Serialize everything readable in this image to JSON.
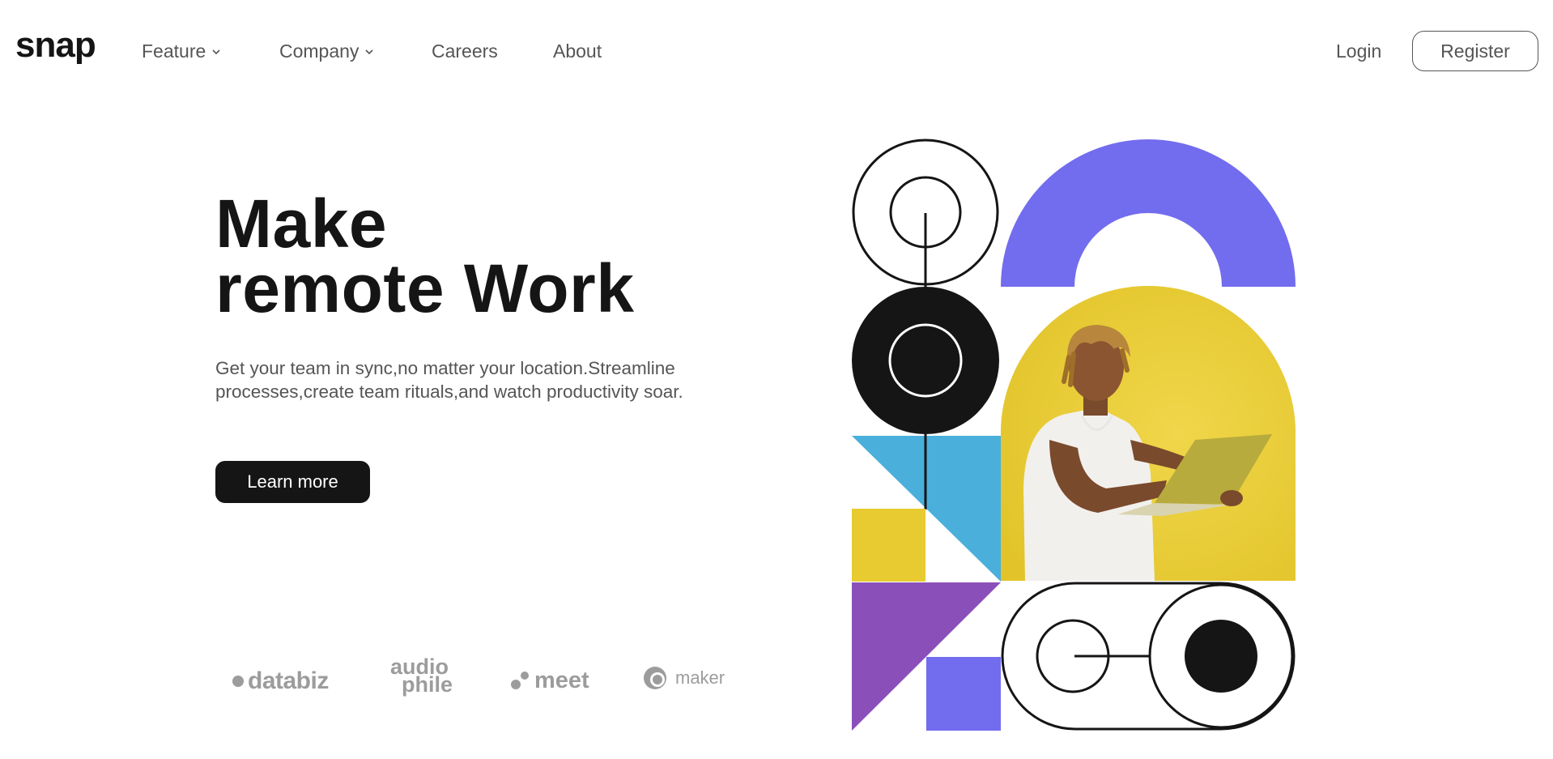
{
  "header": {
    "logo": "snap",
    "nav": [
      {
        "label": "Feature",
        "has_dropdown": true,
        "icon": "chevron-down-icon"
      },
      {
        "label": "Company",
        "has_dropdown": true,
        "icon": "chevron-down-icon"
      },
      {
        "label": "Careers",
        "has_dropdown": false
      },
      {
        "label": "About",
        "has_dropdown": false
      }
    ],
    "login_label": "Login",
    "register_label": "Register"
  },
  "hero": {
    "title_line1": "Make",
    "title_line2": "remote Work",
    "description": "Get your team in sync,no matter your location.Streamline processes,create team rituals,and watch productivity soar.",
    "cta_label": "Learn more"
  },
  "clients": [
    {
      "name": "databiz"
    },
    {
      "name_line1": "audio",
      "name_line2": "phile"
    },
    {
      "name": "meet"
    },
    {
      "name": "maker"
    }
  ],
  "colors": {
    "text_dark": "#151515",
    "text_gray": "#555555",
    "logo_gray": "#9c9c9c",
    "purple_arc": "#726cee",
    "yellow": "#e7cb30",
    "blue": "#4aafdb",
    "violet": "#8b4fba",
    "square_purple": "#726cee"
  },
  "illustration": {
    "photo_description": "person-with-laptop",
    "shapes": [
      "ring-with-line-icon",
      "black-circle-icon",
      "purple-arch-icon",
      "blue-triangle-icon",
      "yellow-square-icon",
      "violet-triangle-icon",
      "purple-square-icon",
      "pill-toggle-icon"
    ]
  }
}
